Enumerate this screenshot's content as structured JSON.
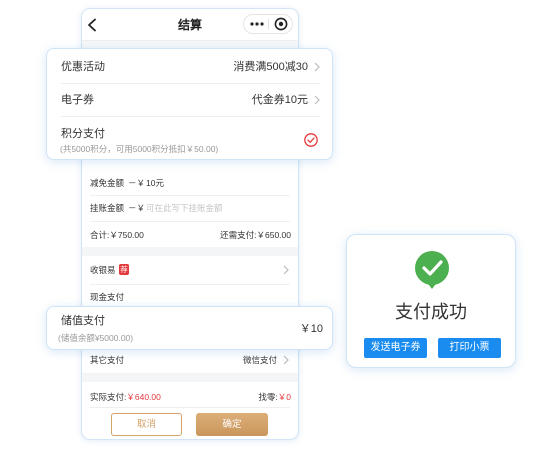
{
  "header": {
    "title": "结算"
  },
  "icons": {
    "back": "chevron-left-icon",
    "more": "more-dots-icon",
    "close": "target-circle-icon",
    "row_arrow": "chevron-right-icon",
    "points_selected": "check-circle-icon",
    "success": "success-check-icon"
  },
  "discounts": {
    "promotion": {
      "label": "优惠活动",
      "value": "消费满500减30"
    },
    "coupon": {
      "label": "电子券",
      "value": "代金券10元"
    },
    "points": {
      "label": "积分支付",
      "note": "(共5000积分，可用5000积分抵扣￥50.00)",
      "selected": true
    }
  },
  "amounts": {
    "reduce": {
      "label": "减免金额",
      "prefix": "－￥",
      "value": "10元"
    },
    "credit": {
      "label": "挂账金额",
      "prefix": "－￥",
      "placeholder": "可在此写下挂账金额"
    },
    "total": {
      "label": "合计:",
      "value": "￥750.00"
    },
    "remaining": {
      "label": "还需支付:",
      "value": "￥650.00"
    }
  },
  "payments": {
    "cashier": {
      "label": "收银易",
      "badge": "荐"
    },
    "cash": {
      "label": "现金支付"
    },
    "stored_value": {
      "label": "储值支付",
      "note": "(储值余额¥5000.00)",
      "amount": "￥10"
    },
    "other": {
      "label": "其它支付",
      "value": "微信支付"
    }
  },
  "summary": {
    "paid_label": "实际支付:",
    "paid_value": "￥640.00",
    "change_label": "找零:",
    "change_value": "￥0"
  },
  "actions": {
    "cancel": "取消",
    "confirm": "确定"
  },
  "success": {
    "title": "支付成功",
    "send_coupon": "发送电子券",
    "print_receipt": "打印小票"
  },
  "colors": {
    "accent_red": "#e4393c",
    "gold": "#d3a36a",
    "action_blue": "#1a8cf0",
    "success_green": "#4caf50",
    "card_border": "#cfe4f7"
  }
}
